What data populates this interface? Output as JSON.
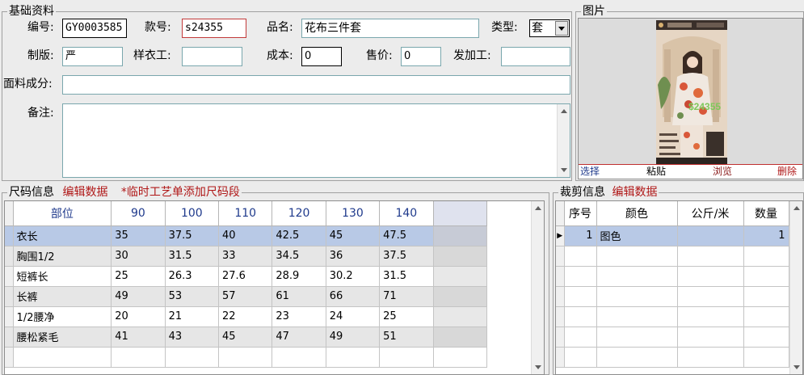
{
  "basic": {
    "title": "基础资料",
    "code_label": "编号:",
    "code_value": "GY0003585",
    "style_label": "款号:",
    "style_value": "s24355",
    "name_label": "品名:",
    "name_value": "花布三件套",
    "type_label": "类型:",
    "type_value": "套",
    "pattern_label": "制版:",
    "pattern_value": "严",
    "sample_label": "样衣工:",
    "sample_value": "",
    "cost_label": "成本:",
    "cost_value": "0",
    "price_label": "售价:",
    "price_value": "0",
    "process_label": "发加工:",
    "process_value": "",
    "fabric_label": "面料成分:",
    "fabric_value": "",
    "note_label": "备注:",
    "note_value": ""
  },
  "photo": {
    "title": "图片",
    "select": "选择",
    "paste": "粘贴",
    "browse": "浏览",
    "delete": "删除",
    "overlay_text": "$24355"
  },
  "sizes": {
    "title": "尺码信息",
    "edit_link": "编辑数据",
    "note": "*临时工艺单添加尺码段",
    "headers": [
      "部位",
      "90",
      "100",
      "110",
      "120",
      "130",
      "140"
    ],
    "rows": [
      [
        "衣长",
        "35",
        "37.5",
        "40",
        "42.5",
        "45",
        "47.5"
      ],
      [
        "胸围1/2",
        "30",
        "31.5",
        "33",
        "34.5",
        "36",
        "37.5"
      ],
      [
        "短裤长",
        "25",
        "26.3",
        "27.6",
        "28.9",
        "30.2",
        "31.5"
      ],
      [
        "长裤",
        "49",
        "53",
        "57",
        "61",
        "66",
        "71"
      ],
      [
        "1/2腰净",
        "20",
        "21",
        "22",
        "23",
        "24",
        "25"
      ],
      [
        "腰松紧毛",
        "41",
        "43",
        "45",
        "47",
        "49",
        "51"
      ]
    ]
  },
  "cutting": {
    "title": "裁剪信息",
    "edit_link": "编辑数据",
    "headers": [
      "序号",
      "颜色",
      "公斤/米",
      "数量"
    ],
    "rows": [
      [
        "1",
        "图色",
        "",
        "1"
      ]
    ]
  }
}
